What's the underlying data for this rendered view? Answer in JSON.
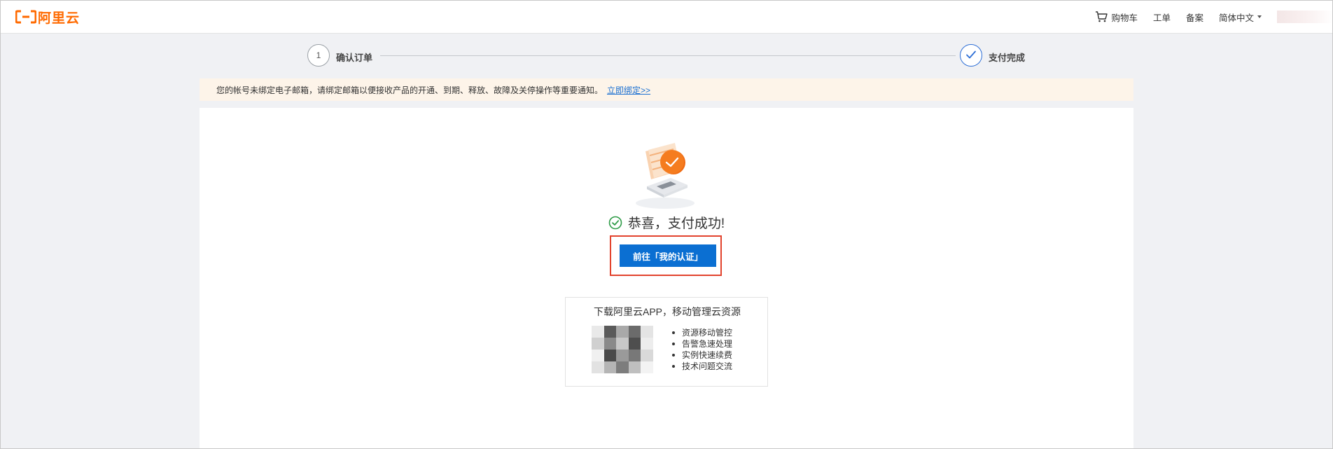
{
  "header": {
    "logo_text": "阿里云",
    "nav": {
      "cart": "购物车",
      "ticket": "工单",
      "filing": "备案",
      "language": "简体中文"
    }
  },
  "steps": [
    {
      "number": "1",
      "label": "确认订单",
      "state": "pending"
    },
    {
      "number": "",
      "label": "支付完成",
      "state": "done"
    }
  ],
  "notice": {
    "text": "您的帐号未绑定电子邮箱，请绑定邮箱以便接收产品的开通、到期、释放、故障及关停操作等重要通知。",
    "link": "立即绑定>>"
  },
  "result": {
    "message": "恭喜，支付成功!",
    "button_label": "前往「我的认证」"
  },
  "app_promo": {
    "title": "下载阿里云APP，移动管理云资源",
    "features": [
      "资源移动管控",
      "告警急速处理",
      "实例快速续费",
      "技术问题交流"
    ]
  },
  "colors": {
    "brand": "#ff6a00",
    "primary_button": "#0b6fd2",
    "highlight_border": "#e2432d",
    "success": "#2e9b47",
    "notice_bg": "#fdf4e9",
    "link": "#1a6fd1"
  },
  "icons": [
    "aliyun-logo",
    "cart-icon",
    "caret-down-icon",
    "check-icon",
    "success-check-icon",
    "payment-illustration",
    "qr-code"
  ]
}
